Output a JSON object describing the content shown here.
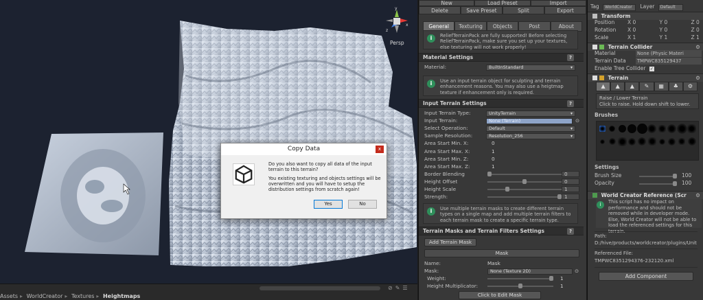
{
  "scene": {
    "persp_label": "Persp",
    "gizmo_axes": {
      "y": "y",
      "x": "x",
      "z": "z"
    }
  },
  "breadcrumb": [
    "Assets",
    "WorldCreator",
    "Textures",
    "Heightmaps"
  ],
  "dialog": {
    "title": "Copy Data",
    "close": "x",
    "message1": "Do you also want to copy all data of the input terrain to this terrain?",
    "message2": "You existing texturing and objects settings will be overwritten and you will have to setup the distribution settings from scratch again!",
    "yes": "Yes",
    "no": "No"
  },
  "toolbar": {
    "row1": [
      "New",
      "Load Preset",
      "Import"
    ],
    "row2": [
      "Delete",
      "Save Preset",
      "Split",
      "Export"
    ]
  },
  "tabs": [
    "General",
    "Texturing",
    "Objects",
    "Post",
    "About"
  ],
  "active_tab": "General",
  "info_top": "ReliefTerrainPack are fully supported! Before selecting ReliefTerrainPack, make sure you set up your textures, else texturing will not work properly!",
  "material_settings": {
    "title": "Material Settings",
    "help": "?",
    "label": "Material:",
    "value": "BuiltInStandard"
  },
  "info_input": "Use an input terrain object for sculpting and terrain enhancement reasons. You may also use a heigtmap texture if enhancement only is required.",
  "input_settings": {
    "title": "Input Terrain Settings",
    "help": "?",
    "rows": [
      {
        "label": "Input Terrain Type:",
        "value": "UnityTerrain",
        "kind": "dropdown"
      },
      {
        "label": "Input Terrain:",
        "value": "None (Terrain)",
        "kind": "object",
        "suffix": "⊙"
      },
      {
        "label": "Select Operation:",
        "value": "Default",
        "kind": "dropdown"
      },
      {
        "label": "Sample Resolution:",
        "value": "Resolution_256",
        "kind": "dropdown"
      },
      {
        "label": "Area Start Min. X:",
        "value": "0",
        "kind": "value"
      },
      {
        "label": "Area Start Max. X:",
        "value": "1",
        "kind": "value"
      },
      {
        "label": "Area Start Min. Z:",
        "value": "0",
        "kind": "value"
      },
      {
        "label": "Area Start Max. Z:",
        "value": "1",
        "kind": "value"
      },
      {
        "label": "Border Blending",
        "value": "0",
        "kind": "slider",
        "level": 0.0
      },
      {
        "label": "Height Offset",
        "value": "0",
        "kind": "slider",
        "level": 0.5
      },
      {
        "label": "Height Scale",
        "value": "1",
        "kind": "slider",
        "level": 0.25
      },
      {
        "label": "Strength:",
        "value": "1",
        "kind": "slider",
        "level": 1.0
      }
    ]
  },
  "info_masks": "Use multiple terrain masks to create different terrain types on a single map and add multiple terrain filters to each terrain mask to create a specific terrain type.",
  "masks": {
    "title": "Terrain Masks and Terrain Filters Settings",
    "help": "?",
    "add_button": "Add Terrain Mask",
    "mask_header": "Mask",
    "name_label": "Name:",
    "name_value": "Mask",
    "mask_label": "Mask:",
    "mask_value": "None (Texture 2D)",
    "weight_label": "Weight:",
    "weight_value": "1",
    "weight_level": 1.0,
    "hm_label": "Height Multiplicator:",
    "hm_value": "1",
    "hm_level": 0.5,
    "edit_button": "Click to Edit Mask"
  },
  "inspector": {
    "tag_label": "Tag",
    "tag_value": "WorldCreator",
    "layer_label": "Layer",
    "layer_value": "Default",
    "transform": {
      "title": "Transform",
      "position": {
        "label": "Position",
        "x": "0",
        "y": "0",
        "z": "0"
      },
      "rotation": {
        "label": "Rotation",
        "x": "0",
        "y": "0",
        "z": "0"
      },
      "scale": {
        "label": "Scale",
        "x": "1",
        "y": "1",
        "z": "1"
      }
    },
    "collider": {
      "title": "Terrain Collider",
      "material_label": "Material",
      "material_value": "None (Physic Materi",
      "data_label": "Terrain Data",
      "data_value": "TMPWC835129437",
      "tree_label": "Enable Tree Collider",
      "tree_checked": true
    },
    "terrain": {
      "title": "Terrain",
      "tools": [
        "▲",
        "▲",
        "▲",
        "✎",
        "▦",
        "♣",
        "⚙"
      ],
      "tool_title": "Raise / Lower Terrain",
      "tool_hint": "Click to raise. Hold down shift to lower.",
      "brushes_label": "Brushes",
      "settings_label": "Settings",
      "brush_size_label": "Brush Size",
      "brush_size_value": "100",
      "brush_size_level": 1.0,
      "opacity_label": "Opacity",
      "opacity_value": "100",
      "opacity_level": 1.0
    },
    "world_ref": {
      "title": "World Creator Reference (Scr",
      "info": "This script has no impact on performance and should not be removed while in developer mode. Else, World Creator will not be able to load the referenced settings for this terrain.",
      "path_label": "Path:",
      "path_value": "D:/hive/products/worldcreator/plugins/Unit",
      "ref_label": "Referenced File:",
      "ref_value": "TMPWC8351294376-232120.xml"
    },
    "add_component": "Add Component"
  },
  "colors": {
    "scene_bg": "#1c2230",
    "panel_bg": "#383838",
    "info_icon": "#2f8f5b",
    "selected_field": "#8ea4c8"
  }
}
